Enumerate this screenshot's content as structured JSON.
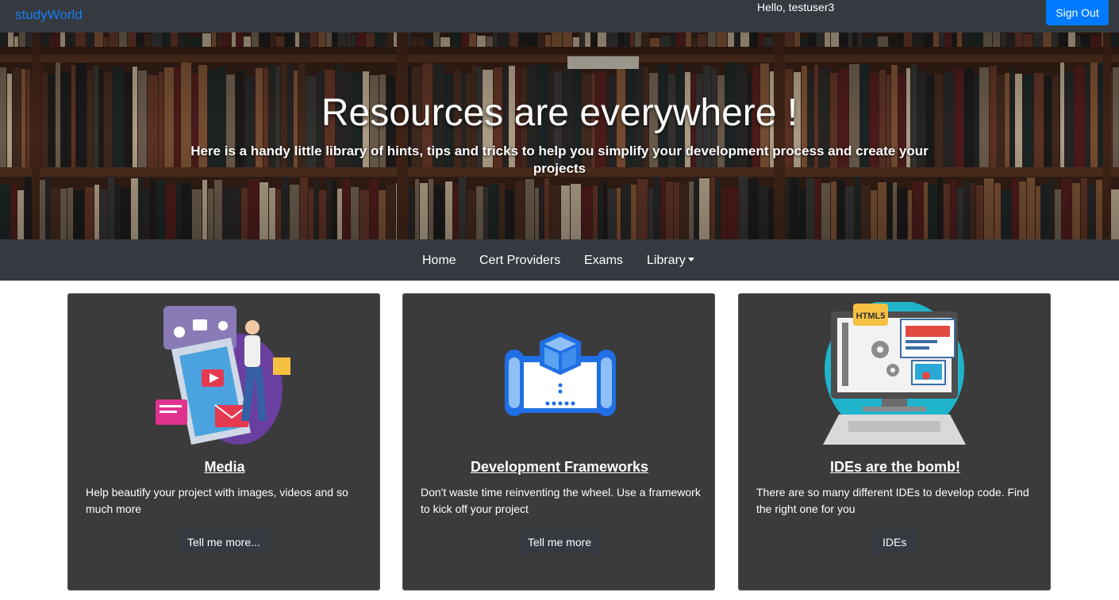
{
  "topbar": {
    "brand": "studyWorld",
    "greeting": "Hello, testuser3",
    "signout_label": "Sign Out",
    "brand_color": "#1a7cf5",
    "signout_color": "#007bff"
  },
  "hero": {
    "title": "Resources are everywhere !",
    "subtitle": "Here is a handy little library of hints, tips and tricks to help you simplify your development process and create your projects"
  },
  "nav": {
    "items": [
      {
        "label": "Home"
      },
      {
        "label": "Cert Providers"
      },
      {
        "label": "Exams"
      },
      {
        "label": "Library"
      }
    ]
  },
  "cards": [
    {
      "title": "Media",
      "text": "Help beautify your project with images, videos and so much more",
      "button": "Tell me more..."
    },
    {
      "title": "Development Frameworks",
      "text": "Don't waste time reinventing the wheel. Use a framework to kick off your project",
      "button": "Tell me more"
    },
    {
      "title": "IDEs are the bomb!",
      "text": "There are so many different IDEs to develop code. Find the right one for you",
      "button": "IDEs",
      "illustration_label": "HTML5"
    }
  ]
}
